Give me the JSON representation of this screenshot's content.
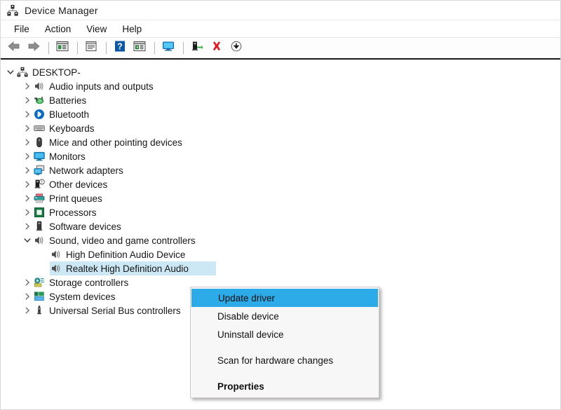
{
  "window": {
    "title": "Device Manager",
    "app_icon": "device-manager-icon"
  },
  "menubar": {
    "items": [
      {
        "label": "File",
        "name": "menu-file"
      },
      {
        "label": "Action",
        "name": "menu-action"
      },
      {
        "label": "View",
        "name": "menu-view"
      },
      {
        "label": "Help",
        "name": "menu-help"
      }
    ]
  },
  "toolbar": {
    "buttons": [
      {
        "icon": "back-arrow-icon",
        "name": "toolbar-back"
      },
      {
        "icon": "forward-arrow-icon",
        "name": "toolbar-forward"
      },
      {
        "icon": "separator",
        "name": "toolbar-separator-1"
      },
      {
        "icon": "show-hide-console-tree-icon",
        "name": "toolbar-console-tree"
      },
      {
        "icon": "separator",
        "name": "toolbar-separator-2"
      },
      {
        "icon": "properties-icon",
        "name": "toolbar-properties"
      },
      {
        "icon": "separator",
        "name": "toolbar-separator-3"
      },
      {
        "icon": "help-icon",
        "name": "toolbar-help"
      },
      {
        "icon": "update-driver-icon",
        "name": "toolbar-update-driver"
      },
      {
        "icon": "separator",
        "name": "toolbar-separator-4"
      },
      {
        "icon": "scan-hardware-changes-icon",
        "name": "toolbar-scan-hardware"
      },
      {
        "icon": "separator",
        "name": "toolbar-separator-5"
      },
      {
        "icon": "enable-device-icon",
        "name": "toolbar-enable-device"
      },
      {
        "icon": "uninstall-device-icon",
        "name": "toolbar-uninstall-device"
      },
      {
        "icon": "download-icon",
        "name": "toolbar-download"
      }
    ]
  },
  "tree": {
    "nodes": [
      {
        "label": "DESKTOP-",
        "icon": "computer-icon",
        "level": 0,
        "state": "expanded",
        "selected": false
      },
      {
        "label": "Audio inputs and outputs",
        "icon": "speaker-icon",
        "level": 1,
        "state": "collapsed",
        "selected": false
      },
      {
        "label": "Batteries",
        "icon": "battery-icon",
        "level": 1,
        "state": "collapsed",
        "selected": false
      },
      {
        "label": "Bluetooth",
        "icon": "bluetooth-icon",
        "level": 1,
        "state": "collapsed",
        "selected": false
      },
      {
        "label": "Keyboards",
        "icon": "keyboard-icon",
        "level": 1,
        "state": "collapsed",
        "selected": false
      },
      {
        "label": "Mice and other pointing devices",
        "icon": "mouse-icon",
        "level": 1,
        "state": "collapsed",
        "selected": false
      },
      {
        "label": "Monitors",
        "icon": "monitor-icon",
        "level": 1,
        "state": "collapsed",
        "selected": false
      },
      {
        "label": "Network adapters",
        "icon": "network-adapter-icon",
        "level": 1,
        "state": "collapsed",
        "selected": false
      },
      {
        "label": "Other devices",
        "icon": "other-device-icon",
        "level": 1,
        "state": "collapsed",
        "selected": false
      },
      {
        "label": "Print queues",
        "icon": "printer-icon",
        "level": 1,
        "state": "collapsed",
        "selected": false
      },
      {
        "label": "Processors",
        "icon": "processor-icon",
        "level": 1,
        "state": "collapsed",
        "selected": false
      },
      {
        "label": "Software devices",
        "icon": "software-device-icon",
        "level": 1,
        "state": "collapsed",
        "selected": false
      },
      {
        "label": "Sound, video and game controllers",
        "icon": "speaker-icon",
        "level": 1,
        "state": "expanded",
        "selected": false
      },
      {
        "label": "High Definition Audio Device",
        "icon": "speaker-icon",
        "level": 2,
        "state": "leaf",
        "selected": false
      },
      {
        "label": "Realtek High Definition Audio",
        "icon": "speaker-icon",
        "level": 2,
        "state": "leaf",
        "selected": true
      },
      {
        "label": "Storage controllers",
        "icon": "storage-controller-icon",
        "level": 1,
        "state": "collapsed",
        "selected": false
      },
      {
        "label": "System devices",
        "icon": "system-device-icon",
        "level": 1,
        "state": "collapsed",
        "selected": false
      },
      {
        "label": "Universal Serial Bus controllers",
        "icon": "usb-icon",
        "level": 1,
        "state": "collapsed",
        "selected": false
      }
    ]
  },
  "context_menu": {
    "items": [
      {
        "label": "Update driver",
        "name": "ctx-update-driver",
        "highlight": true,
        "bold": false,
        "gap_after": false
      },
      {
        "label": "Disable device",
        "name": "ctx-disable-device",
        "highlight": false,
        "bold": false,
        "gap_after": false
      },
      {
        "label": "Uninstall device",
        "name": "ctx-uninstall-device",
        "highlight": false,
        "bold": false,
        "gap_after": true
      },
      {
        "label": "Scan for hardware changes",
        "name": "ctx-scan-hardware-changes",
        "highlight": false,
        "bold": false,
        "gap_after": true
      },
      {
        "label": "Properties",
        "name": "ctx-properties",
        "highlight": false,
        "bold": true,
        "gap_after": false
      }
    ]
  },
  "colors": {
    "selection_highlight": "#cce8f4",
    "menu_highlight": "#2dabe8",
    "window_bg": "#ffffff",
    "menu_bg": "#f7f7f7",
    "toolbar_rule": "#1b1b1b"
  }
}
